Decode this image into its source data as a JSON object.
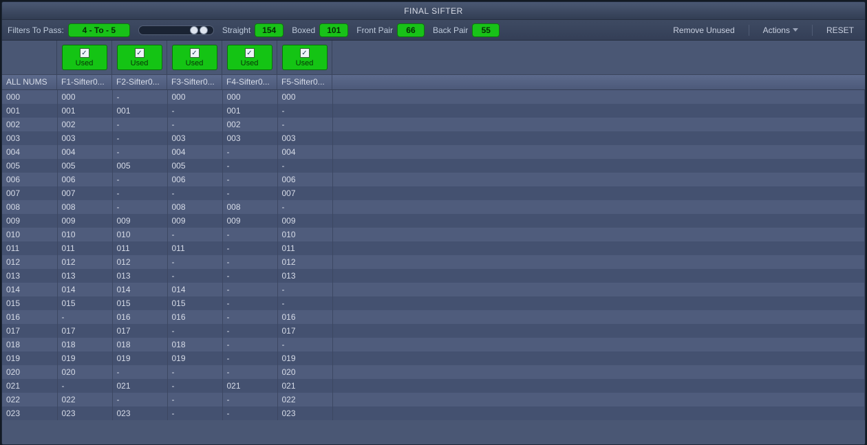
{
  "title": "FINAL SIFTER",
  "toolbar": {
    "filters_to_pass_label": "Filters To Pass:",
    "filters_to_pass_value": "4 - To - 5",
    "straight_label": "Straight",
    "straight_value": "154",
    "boxed_label": "Boxed",
    "boxed_value": "101",
    "front_pair_label": "Front Pair",
    "front_pair_value": "66",
    "back_pair_label": "Back Pair",
    "back_pair_value": "55",
    "remove_unused": "Remove Unused",
    "actions": "Actions",
    "reset": "RESET"
  },
  "columns": {
    "all_nums": "ALL NUMS",
    "filters": [
      "F1-Sifter0...",
      "F2-Sifter0...",
      "F3-Sifter0...",
      "F4-Sifter0...",
      "F5-Sifter0..."
    ],
    "used_label": "Used"
  },
  "rows": [
    {
      "num": "000",
      "f": [
        "000",
        "-",
        "000",
        "000",
        "000"
      ]
    },
    {
      "num": "001",
      "f": [
        "001",
        "001",
        "-",
        "001",
        "-"
      ]
    },
    {
      "num": "002",
      "f": [
        "002",
        "-",
        "-",
        "002",
        "-"
      ]
    },
    {
      "num": "003",
      "f": [
        "003",
        "-",
        "003",
        "003",
        "003"
      ]
    },
    {
      "num": "004",
      "f": [
        "004",
        "-",
        "004",
        "-",
        "004"
      ]
    },
    {
      "num": "005",
      "f": [
        "005",
        "005",
        "005",
        "-",
        "-"
      ]
    },
    {
      "num": "006",
      "f": [
        "006",
        "-",
        "006",
        "-",
        "006"
      ]
    },
    {
      "num": "007",
      "f": [
        "007",
        "-",
        "-",
        "-",
        "007"
      ]
    },
    {
      "num": "008",
      "f": [
        "008",
        "-",
        "008",
        "008",
        "-"
      ]
    },
    {
      "num": "009",
      "f": [
        "009",
        "009",
        "009",
        "009",
        "009"
      ]
    },
    {
      "num": "010",
      "f": [
        "010",
        "010",
        "-",
        "-",
        "010"
      ]
    },
    {
      "num": "011",
      "f": [
        "011",
        "011",
        "011",
        "-",
        "011"
      ]
    },
    {
      "num": "012",
      "f": [
        "012",
        "012",
        "-",
        "-",
        "012"
      ]
    },
    {
      "num": "013",
      "f": [
        "013",
        "013",
        "-",
        "-",
        "013"
      ]
    },
    {
      "num": "014",
      "f": [
        "014",
        "014",
        "014",
        "-",
        "-"
      ]
    },
    {
      "num": "015",
      "f": [
        "015",
        "015",
        "015",
        "-",
        "-"
      ]
    },
    {
      "num": "016",
      "f": [
        "-",
        "016",
        "016",
        "-",
        "016"
      ]
    },
    {
      "num": "017",
      "f": [
        "017",
        "017",
        "-",
        "-",
        "017"
      ]
    },
    {
      "num": "018",
      "f": [
        "018",
        "018",
        "018",
        "-",
        "-"
      ]
    },
    {
      "num": "019",
      "f": [
        "019",
        "019",
        "019",
        "-",
        "019"
      ]
    },
    {
      "num": "020",
      "f": [
        "020",
        "-",
        "-",
        "-",
        "020"
      ]
    },
    {
      "num": "021",
      "f": [
        "-",
        "021",
        "-",
        "021",
        "021"
      ]
    },
    {
      "num": "022",
      "f": [
        "022",
        "-",
        "-",
        "-",
        "022"
      ]
    },
    {
      "num": "023",
      "f": [
        "023",
        "023",
        "-",
        "-",
        "023"
      ]
    }
  ]
}
